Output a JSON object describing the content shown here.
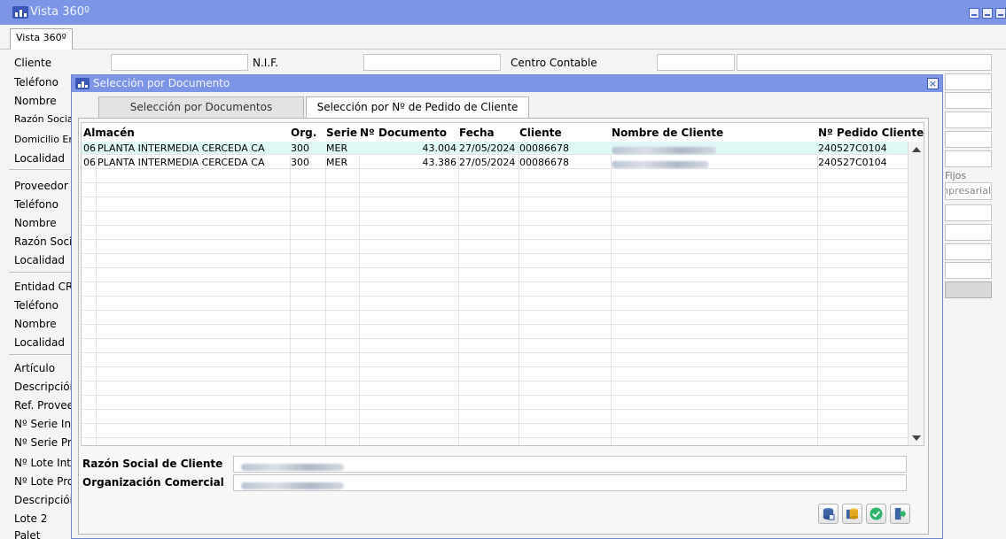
{
  "window": {
    "title": "Vista 360º",
    "tab": "Vista 360º"
  },
  "form": {
    "cliente": "Cliente",
    "nif": "N.I.F.",
    "centro_contable": "Centro Contable",
    "labels": [
      "Teléfono",
      "Nombre",
      "Razón Social",
      "Domicilio Envío",
      "Localidad",
      "Proveedor",
      "Teléfono",
      "Nombre",
      "Razón Social",
      "Localidad",
      "Entidad CRM",
      "Teléfono",
      "Nombre",
      "Localidad",
      "Artículo",
      "Descripción",
      "Ref. Proveedor",
      "Nº Serie Interno",
      "Nº Serie Proveedor",
      "Nº Lote Interno",
      "Nº Lote Proveedor",
      "Descripción",
      "Lote 2",
      "Palet"
    ],
    "fijos_label": "Fijos",
    "empresarial_value": "Empresarial"
  },
  "dialog": {
    "title": "Selección por Documento",
    "tabs": [
      {
        "label": "Selección por Documentos",
        "active": false
      },
      {
        "label": "Selección por Nº de Pedido de Cliente",
        "active": true
      }
    ],
    "grid": {
      "columns": {
        "almacen": "Almacén",
        "org": "Org.",
        "serie": "Serie",
        "n_documento": "Nº Documento",
        "fecha": "Fecha",
        "cliente": "Cliente",
        "nombre_cliente": "Nombre de Cliente",
        "n_pedido_cliente": "Nº Pedido Cliente"
      },
      "rows": [
        {
          "almacen": "06",
          "almacen_nombre": "PLANTA INTERMEDIA CERCEDA CA",
          "org": "300",
          "serie": "MER",
          "n_documento": "43.004",
          "fecha": "27/05/2024",
          "cliente": "00086678",
          "n_pedido_cliente": "240527C0104"
        },
        {
          "almacen": "06",
          "almacen_nombre": "PLANTA INTERMEDIA CERCEDA CA",
          "org": "300",
          "serie": "MER",
          "n_documento": "43.386",
          "fecha": "27/05/2024",
          "cliente": "00086678",
          "n_pedido_cliente": "240527C0104"
        }
      ]
    },
    "razon_social_label": "Razón Social de Cliente",
    "organizacion_label": "Organización Comercial"
  },
  "icons": [
    "app-logo-icon",
    "minimize-icon",
    "restore-icon",
    "close-icon",
    "database-icon",
    "database-gold-icon",
    "accept-check-icon",
    "exit-icon"
  ],
  "colors": {
    "titlebar": "#7c95e6",
    "selected_row": "#dff7f5",
    "accept": "#2fb36b"
  }
}
